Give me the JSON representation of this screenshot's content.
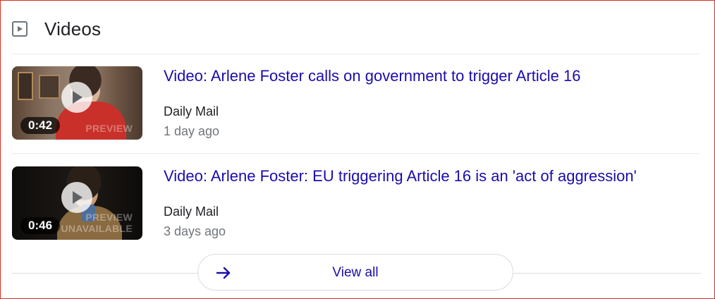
{
  "header": {
    "title": "Videos",
    "icon": "play-box-icon"
  },
  "videos": [
    {
      "title": "Video: Arlene Foster calls on government to trigger Article 16",
      "source": "Daily Mail",
      "age": "1 day ago",
      "duration": "0:42",
      "watermark": "PREVIEW"
    },
    {
      "title": "Video: Arlene Foster: EU triggering Article 16 is an 'act of aggression'",
      "source": "Daily Mail",
      "age": "3 days ago",
      "duration": "0:46",
      "watermark": "PREVIEW UNAVAILABLE"
    }
  ],
  "view_all": {
    "label": "View all",
    "icon": "arrow-right-icon"
  },
  "colors": {
    "link": "#1a0dab",
    "muted": "#70757a",
    "text": "#202124",
    "border": "#d93025"
  }
}
